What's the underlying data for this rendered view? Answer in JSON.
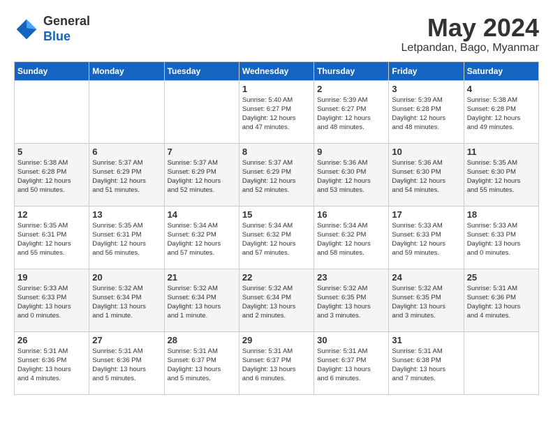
{
  "header": {
    "logo_general": "General",
    "logo_blue": "Blue",
    "month_title": "May 2024",
    "location": "Letpandan, Bago, Myanmar"
  },
  "weekdays": [
    "Sunday",
    "Monday",
    "Tuesday",
    "Wednesday",
    "Thursday",
    "Friday",
    "Saturday"
  ],
  "weeks": [
    [
      {
        "day": "",
        "info": ""
      },
      {
        "day": "",
        "info": ""
      },
      {
        "day": "",
        "info": ""
      },
      {
        "day": "1",
        "info": "Sunrise: 5:40 AM\nSunset: 6:27 PM\nDaylight: 12 hours\nand 47 minutes."
      },
      {
        "day": "2",
        "info": "Sunrise: 5:39 AM\nSunset: 6:27 PM\nDaylight: 12 hours\nand 48 minutes."
      },
      {
        "day": "3",
        "info": "Sunrise: 5:39 AM\nSunset: 6:28 PM\nDaylight: 12 hours\nand 48 minutes."
      },
      {
        "day": "4",
        "info": "Sunrise: 5:38 AM\nSunset: 6:28 PM\nDaylight: 12 hours\nand 49 minutes."
      }
    ],
    [
      {
        "day": "5",
        "info": "Sunrise: 5:38 AM\nSunset: 6:28 PM\nDaylight: 12 hours\nand 50 minutes."
      },
      {
        "day": "6",
        "info": "Sunrise: 5:37 AM\nSunset: 6:29 PM\nDaylight: 12 hours\nand 51 minutes."
      },
      {
        "day": "7",
        "info": "Sunrise: 5:37 AM\nSunset: 6:29 PM\nDaylight: 12 hours\nand 52 minutes."
      },
      {
        "day": "8",
        "info": "Sunrise: 5:37 AM\nSunset: 6:29 PM\nDaylight: 12 hours\nand 52 minutes."
      },
      {
        "day": "9",
        "info": "Sunrise: 5:36 AM\nSunset: 6:30 PM\nDaylight: 12 hours\nand 53 minutes."
      },
      {
        "day": "10",
        "info": "Sunrise: 5:36 AM\nSunset: 6:30 PM\nDaylight: 12 hours\nand 54 minutes."
      },
      {
        "day": "11",
        "info": "Sunrise: 5:35 AM\nSunset: 6:30 PM\nDaylight: 12 hours\nand 55 minutes."
      }
    ],
    [
      {
        "day": "12",
        "info": "Sunrise: 5:35 AM\nSunset: 6:31 PM\nDaylight: 12 hours\nand 55 minutes."
      },
      {
        "day": "13",
        "info": "Sunrise: 5:35 AM\nSunset: 6:31 PM\nDaylight: 12 hours\nand 56 minutes."
      },
      {
        "day": "14",
        "info": "Sunrise: 5:34 AM\nSunset: 6:32 PM\nDaylight: 12 hours\nand 57 minutes."
      },
      {
        "day": "15",
        "info": "Sunrise: 5:34 AM\nSunset: 6:32 PM\nDaylight: 12 hours\nand 57 minutes."
      },
      {
        "day": "16",
        "info": "Sunrise: 5:34 AM\nSunset: 6:32 PM\nDaylight: 12 hours\nand 58 minutes."
      },
      {
        "day": "17",
        "info": "Sunrise: 5:33 AM\nSunset: 6:33 PM\nDaylight: 12 hours\nand 59 minutes."
      },
      {
        "day": "18",
        "info": "Sunrise: 5:33 AM\nSunset: 6:33 PM\nDaylight: 13 hours\nand 0 minutes."
      }
    ],
    [
      {
        "day": "19",
        "info": "Sunrise: 5:33 AM\nSunset: 6:33 PM\nDaylight: 13 hours\nand 0 minutes."
      },
      {
        "day": "20",
        "info": "Sunrise: 5:32 AM\nSunset: 6:34 PM\nDaylight: 13 hours\nand 1 minute."
      },
      {
        "day": "21",
        "info": "Sunrise: 5:32 AM\nSunset: 6:34 PM\nDaylight: 13 hours\nand 1 minute."
      },
      {
        "day": "22",
        "info": "Sunrise: 5:32 AM\nSunset: 6:34 PM\nDaylight: 13 hours\nand 2 minutes."
      },
      {
        "day": "23",
        "info": "Sunrise: 5:32 AM\nSunset: 6:35 PM\nDaylight: 13 hours\nand 3 minutes."
      },
      {
        "day": "24",
        "info": "Sunrise: 5:32 AM\nSunset: 6:35 PM\nDaylight: 13 hours\nand 3 minutes."
      },
      {
        "day": "25",
        "info": "Sunrise: 5:31 AM\nSunset: 6:36 PM\nDaylight: 13 hours\nand 4 minutes."
      }
    ],
    [
      {
        "day": "26",
        "info": "Sunrise: 5:31 AM\nSunset: 6:36 PM\nDaylight: 13 hours\nand 4 minutes."
      },
      {
        "day": "27",
        "info": "Sunrise: 5:31 AM\nSunset: 6:36 PM\nDaylight: 13 hours\nand 5 minutes."
      },
      {
        "day": "28",
        "info": "Sunrise: 5:31 AM\nSunset: 6:37 PM\nDaylight: 13 hours\nand 5 minutes."
      },
      {
        "day": "29",
        "info": "Sunrise: 5:31 AM\nSunset: 6:37 PM\nDaylight: 13 hours\nand 6 minutes."
      },
      {
        "day": "30",
        "info": "Sunrise: 5:31 AM\nSunset: 6:37 PM\nDaylight: 13 hours\nand 6 minutes."
      },
      {
        "day": "31",
        "info": "Sunrise: 5:31 AM\nSunset: 6:38 PM\nDaylight: 13 hours\nand 7 minutes."
      },
      {
        "day": "",
        "info": ""
      }
    ]
  ]
}
